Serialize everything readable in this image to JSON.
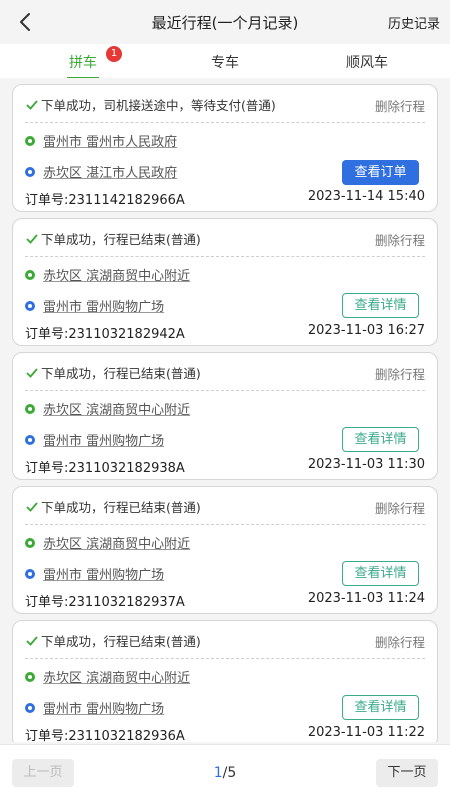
{
  "header": {
    "title": "最近行程(一个月记录)",
    "history_label": "历史记录"
  },
  "tabs": [
    {
      "label": "拼车",
      "active": true,
      "badge": "1"
    },
    {
      "label": "专车",
      "active": false
    },
    {
      "label": "顺风车",
      "active": false
    }
  ],
  "colors": {
    "accent_green": "#3aaa35",
    "primary_blue": "#2f6fe0",
    "badge_red": "#e53935",
    "outline_teal": "#3aaa8c"
  },
  "trips": [
    {
      "status": "下单成功，司机接送途中，等待支付(普通)",
      "delete_label": "删除行程",
      "from": "雷州市 雷州市人民政府",
      "to": "赤坎区 湛江市人民政府",
      "action_label": "查看订单",
      "action_style": "primary",
      "order_no": "订单号:2311142182966A",
      "time": "2023-11-14 15:40"
    },
    {
      "status": "下单成功，行程已结束(普通)",
      "delete_label": "删除行程",
      "from": "赤坎区 滨湖商贸中心附近",
      "to": "雷州市 雷州购物广场",
      "action_label": "查看详情",
      "action_style": "outline",
      "order_no": "订单号:2311032182942A",
      "time": "2023-11-03 16:27"
    },
    {
      "status": "下单成功，行程已结束(普通)",
      "delete_label": "删除行程",
      "from": "赤坎区 滨湖商贸中心附近",
      "to": "雷州市 雷州购物广场",
      "action_label": "查看详情",
      "action_style": "outline",
      "order_no": "订单号:2311032182938A",
      "time": "2023-11-03 11:30"
    },
    {
      "status": "下单成功，行程已结束(普通)",
      "delete_label": "删除行程",
      "from": "赤坎区 滨湖商贸中心附近",
      "to": "雷州市 雷州购物广场",
      "action_label": "查看详情",
      "action_style": "outline",
      "order_no": "订单号:2311032182937A",
      "time": "2023-11-03 11:24"
    },
    {
      "status": "下单成功，行程已结束(普通)",
      "delete_label": "删除行程",
      "from": "赤坎区 滨湖商贸中心附近",
      "to": "雷州市 雷州购物广场",
      "action_label": "查看详情",
      "action_style": "outline",
      "order_no": "订单号:2311032182936A",
      "time": "2023-11-03 11:22"
    }
  ],
  "pagination": {
    "prev_label": "上一页",
    "next_label": "下一页",
    "current": "1",
    "separator": "/",
    "total": "5"
  }
}
